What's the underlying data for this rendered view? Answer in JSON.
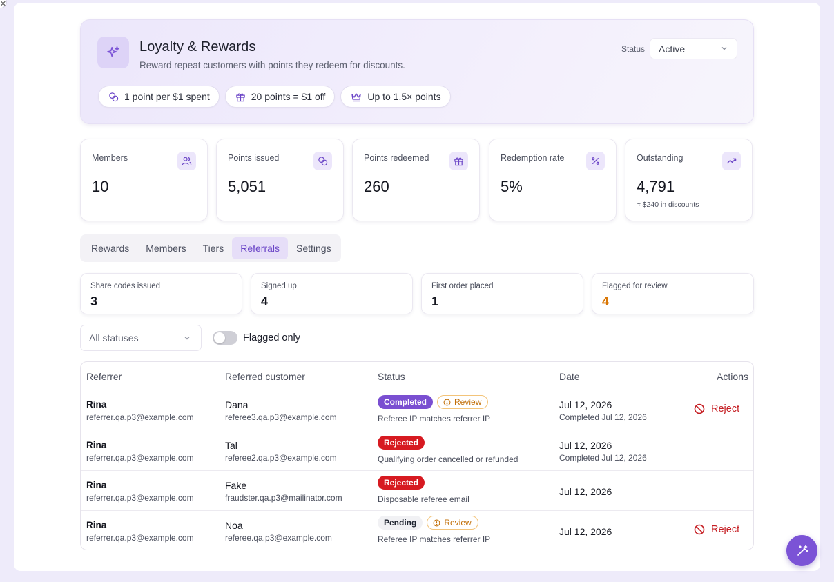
{
  "header": {
    "title": "Loyalty & Rewards",
    "subtitle": "Reward repeat customers with points they redeem for discounts.",
    "icon": "sparkles-icon",
    "status_label": "Status",
    "status_value": "Active",
    "pills": [
      {
        "icon": "coins-icon",
        "label": "1 point per $1 spent"
      },
      {
        "icon": "gift-icon",
        "label": "20 points = $1 off"
      },
      {
        "icon": "crown-icon",
        "label": "Up to 1.5× points"
      }
    ]
  },
  "stats": [
    {
      "label": "Members",
      "value": "10",
      "icon": "users-icon",
      "note": ""
    },
    {
      "label": "Points issued",
      "value": "5,051",
      "icon": "coins-icon",
      "note": ""
    },
    {
      "label": "Points redeemed",
      "value": "260",
      "icon": "gift-icon",
      "note": ""
    },
    {
      "label": "Redemption rate",
      "value": "5%",
      "icon": "percent-icon",
      "note": ""
    },
    {
      "label": "Outstanding",
      "value": "4,791",
      "icon": "trending-up-icon",
      "note": "≈ $240 in discounts"
    }
  ],
  "tabs": [
    "Rewards",
    "Members",
    "Tiers",
    "Referrals",
    "Settings"
  ],
  "active_tab": "Referrals",
  "referral_stats": [
    {
      "label": "Share codes issued",
      "value": "3"
    },
    {
      "label": "Signed up",
      "value": "4"
    },
    {
      "label": "First order placed",
      "value": "1"
    },
    {
      "label": "Flagged for review",
      "value": "4"
    }
  ],
  "filters": {
    "status_filter": "All statuses",
    "flagged_only_label": "Flagged only",
    "flagged_only_on": false
  },
  "table": {
    "columns": [
      "Referrer",
      "Referred customer",
      "Status",
      "Date",
      "Actions"
    ],
    "review_label": "Review",
    "reject_label": "Reject",
    "rows": [
      {
        "referrer": "Rina",
        "referrer_email": "referrer.qa.p3@example.com",
        "referred": "Dana",
        "referred_email": "referee3.qa.p3@example.com",
        "status": "Completed",
        "review": true,
        "reason": "Referee IP matches referrer IP",
        "date": "Jul 12, 2026",
        "completed": "Completed Jul 12, 2026",
        "reject": true
      },
      {
        "referrer": "Rina",
        "referrer_email": "referrer.qa.p3@example.com",
        "referred": "Tal",
        "referred_email": "referee2.qa.p3@example.com",
        "status": "Rejected",
        "review": false,
        "reason": "Qualifying order cancelled or refunded",
        "date": "Jul 12, 2026",
        "completed": "Completed Jul 12, 2026",
        "reject": false
      },
      {
        "referrer": "Rina",
        "referrer_email": "referrer.qa.p3@example.com",
        "referred": "Fake",
        "referred_email": "fraudster.qa.p3@mailinator.com",
        "status": "Rejected",
        "review": false,
        "reason": "Disposable referee email",
        "date": "Jul 12, 2026",
        "completed": "",
        "reject": false
      },
      {
        "referrer": "Rina",
        "referrer_email": "referrer.qa.p3@example.com",
        "referred": "Noa",
        "referred_email": "referee.qa.p3@example.com",
        "status": "Pending",
        "review": true,
        "reason": "Referee IP matches referrer IP",
        "date": "Jul 12, 2026",
        "completed": "",
        "reject": true
      }
    ]
  },
  "colors": {
    "accent": "#7b53d6",
    "danger": "#d71a21",
    "warning": "#c16e06",
    "flagged_value": "#d97706"
  },
  "fab_icon": "magic-wand-icon",
  "close_icon": "close-icon"
}
